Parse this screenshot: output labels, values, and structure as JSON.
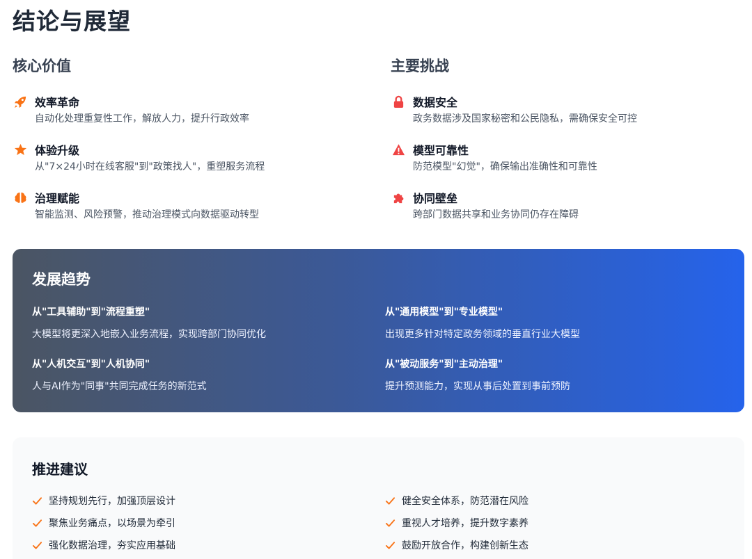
{
  "page_title": "结论与展望",
  "core_values": {
    "title": "核心价值",
    "items": [
      {
        "icon": "rocket-icon",
        "name": "效率革命",
        "desc": "自动化处理重复性工作，解放人力，提升行政效率"
      },
      {
        "icon": "star-icon",
        "name": "体验升级",
        "desc": "从\"7×24小时在线客服\"到\"政策找人\"，重塑服务流程"
      },
      {
        "icon": "brain-icon",
        "name": "治理赋能",
        "desc": "智能监测、风险预警，推动治理模式向数据驱动转型"
      }
    ]
  },
  "challenges": {
    "title": "主要挑战",
    "items": [
      {
        "icon": "lock-icon",
        "name": "数据安全",
        "desc": "政务数据涉及国家秘密和公民隐私，需确保安全可控"
      },
      {
        "icon": "warning-icon",
        "name": "模型可靠性",
        "desc": "防范模型\"幻觉\"，确保输出准确性和可靠性"
      },
      {
        "icon": "puzzle-icon",
        "name": "协同壁垒",
        "desc": "跨部门数据共享和业务协同仍存在障碍"
      }
    ]
  },
  "trends": {
    "title": "发展趋势",
    "items": [
      {
        "heading": "从\"工具辅助\"到\"流程重塑\"",
        "desc": "大模型将更深入地嵌入业务流程，实现跨部门协同优化"
      },
      {
        "heading": "从\"通用模型\"到\"专业模型\"",
        "desc": "出现更多针对特定政务领域的垂直行业大模型"
      },
      {
        "heading": "从\"人机交互\"到\"人机协同\"",
        "desc": "人与AI作为\"同事\"共同完成任务的新范式"
      },
      {
        "heading": "从\"被动服务\"到\"主动治理\"",
        "desc": "提升预测能力，实现从事后处置到事前预防"
      }
    ]
  },
  "suggestions": {
    "title": "推进建议",
    "items": [
      "坚持规划先行，加强顶层设计",
      "健全安全体系，防范潜在风险",
      "聚焦业务痛点，以场景为牵引",
      "重视人才培养，提升数字素养",
      "强化数据治理，夯实应用基础",
      "鼓励开放合作，构建创新生态"
    ]
  },
  "colors": {
    "accent_orange": "#f97316",
    "accent_red": "#ef4444",
    "gradient_start": "#4b5563",
    "gradient_end": "#2563eb"
  }
}
